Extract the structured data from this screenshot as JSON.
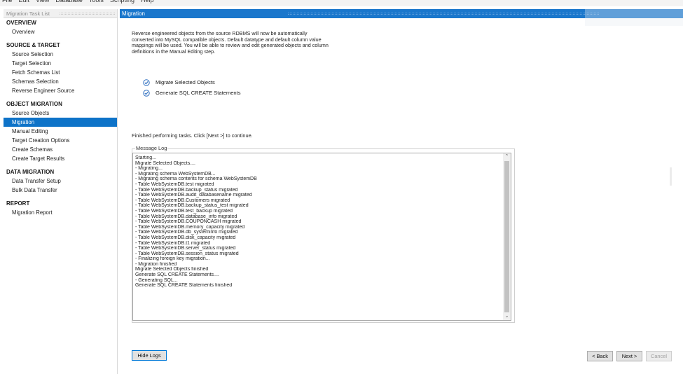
{
  "menu": [
    "File",
    "Edit",
    "View",
    "Database",
    "Tools",
    "Scripting",
    "Help"
  ],
  "sidebar": {
    "header": "Migration Task List",
    "sections": [
      {
        "title": "OVERVIEW",
        "items": [
          {
            "label": "Overview",
            "active": false
          }
        ]
      },
      {
        "title": "SOURCE & TARGET",
        "items": [
          {
            "label": "Source Selection",
            "active": false
          },
          {
            "label": "Target Selection",
            "active": false
          },
          {
            "label": "Fetch Schemas List",
            "active": false
          },
          {
            "label": "Schemas Selection",
            "active": false
          },
          {
            "label": "Reverse Engineer Source",
            "active": false
          }
        ]
      },
      {
        "title": "OBJECT MIGRATION",
        "items": [
          {
            "label": "Source Objects",
            "active": false
          },
          {
            "label": "Migration",
            "active": true
          },
          {
            "label": "Manual Editing",
            "active": false
          },
          {
            "label": "Target Creation Options",
            "active": false
          },
          {
            "label": "Create Schemas",
            "active": false
          },
          {
            "label": "Create Target Results",
            "active": false
          }
        ]
      },
      {
        "title": "DATA MIGRATION",
        "items": [
          {
            "label": "Data Transfer Setup",
            "active": false
          },
          {
            "label": "Bulk Data Transfer",
            "active": false
          }
        ]
      },
      {
        "title": "REPORT",
        "items": [
          {
            "label": "Migration Report",
            "active": false
          }
        ]
      }
    ]
  },
  "main": {
    "title": "Migration",
    "intro_lines": [
      "Reverse engineered objects from the source RDBMS will now be automatically",
      "converted into MySQL compatible objects. Default datatype and default column value",
      "mappings will be used. You will be able to review and edit generated objects and column",
      "definitions in the Manual Editing step."
    ],
    "tasks": [
      {
        "label": "Migrate Selected Objects",
        "icon": "check-circle-icon"
      },
      {
        "label": "Generate SQL CREATE Statements",
        "icon": "check-circle-icon"
      }
    ],
    "status": "Finished performing tasks. Click [Next >] to continue.",
    "log_label": "Message Log",
    "log_lines": [
      "Starting...",
      "Migrate Selected Objects....",
      "- Migrating...",
      "- Migrating schema WebSystemDB...",
      "- Migrating schema contents for schema WebSystemDB",
      "- Table WebSystemDB.test migrated",
      "- Table WebSystemDB.backup_status migrated",
      "- Table WebSystemDB.audit_databasename migrated",
      "- Table WebSystemDB.Customers migrated",
      "- Table WebSystemDB.backup_status_test migrated",
      "- Table WebSystemDB.test_backup migrated",
      "- Table WebSystemDB.database_info migrated",
      "- Table WebSystemDB.COUPONCASH migrated",
      "- Table WebSystemDB.memory_capacity migrated",
      "- Table WebSystemDB.db_systeminfo migrated",
      "- Table WebSystemDB.disk_capacity migrated",
      "- Table WebSystemDB.t1 migrated",
      "- Table WebSystemDB.server_status migrated",
      "- Table WebSystemDB.session_status migrated",
      "- Finalizing foreign key migration...",
      "- Migration finished",
      "Migrate Selected Objects finished",
      "Generate SQL CREATE Statements....",
      "- Generating SQL...",
      "Generate SQL CREATE Statements finished"
    ]
  },
  "buttons": {
    "hide_logs": "Hide Logs",
    "back": "< Back",
    "next": "Next >",
    "cancel": "Cancel"
  },
  "colors": {
    "accent": "#1a77cc",
    "active_nav": "#0e73c8",
    "check_icon": "#2f6fc0"
  }
}
